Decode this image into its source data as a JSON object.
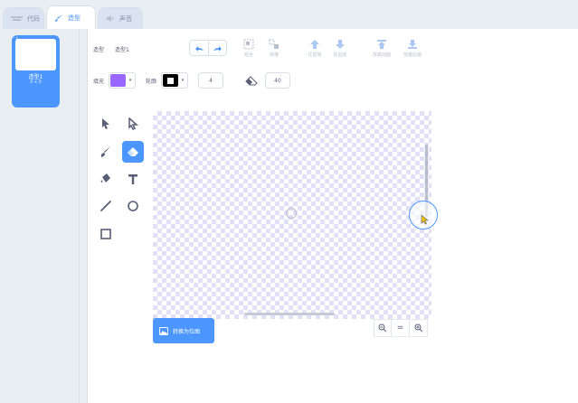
{
  "tabs": [
    {
      "label": "代码",
      "icon": "code-icon"
    },
    {
      "label": "造型",
      "icon": "paintbrush-icon",
      "active": true
    },
    {
      "label": "声音",
      "icon": "speaker-icon"
    }
  ],
  "costumes": [
    {
      "number": "1",
      "name": "造型1",
      "size": "0 x 0",
      "selected": true
    }
  ],
  "toolbar": {
    "costume_label": "造型",
    "costume_name": "造型1",
    "group_label": "组合",
    "ungroup_label": "拆散",
    "forward_label": "往前放",
    "backward_label": "往后放",
    "front_label": "放最前面",
    "back_label": "放最后面",
    "fill_label": "填充",
    "fill_color": "#9966ff",
    "outline_label": "轮廓",
    "outline_color": "#000000",
    "outline_width": "4",
    "eraser_size": "40"
  },
  "tools": [
    "select-tool",
    "reshape-tool",
    "brush-tool",
    "eraser-tool",
    "fill-tool",
    "text-tool",
    "line-tool",
    "circle-tool",
    "rectangle-tool"
  ],
  "active_tool": "eraser-tool",
  "canvas": {
    "convert_label": "转换为位图",
    "zoom_reset_label": "="
  },
  "colors": {
    "accent": "#4c97ff",
    "fill": "#9966ff",
    "checker": "#e2e0f7"
  }
}
